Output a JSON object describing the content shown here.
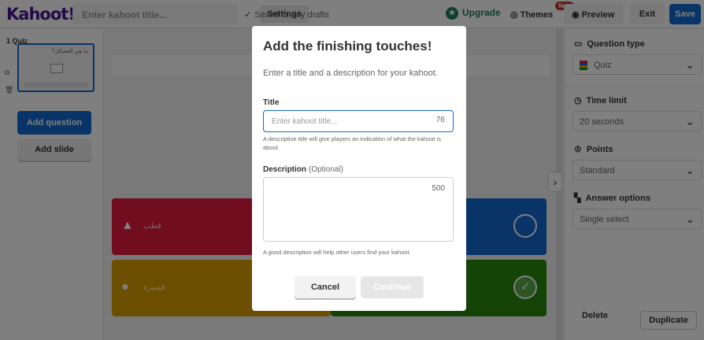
{
  "topbar": {
    "logo": "Kahoot!",
    "title_placeholder": "Enter kahoot title...",
    "settings_label": "Settings",
    "saved_text": "Saved to: My drafts",
    "upgrade_label": "Upgrade",
    "themes_label": "Themes",
    "new_badge": "New",
    "preview_label": "Preview",
    "exit_label": "Exit",
    "save_label": "Save"
  },
  "sidebar": {
    "slide_label": "1 Quiz",
    "slide_question_text": "ما هي الفصائل؟",
    "add_question_label": "Add question",
    "add_slide_label": "Add slide"
  },
  "answers": {
    "red_text": "قطب",
    "yellow_text": "فسيرة"
  },
  "right_panel": {
    "question_type_heading": "Question type",
    "question_type_value": "Quiz",
    "time_limit_heading": "Time limit",
    "time_limit_value": "20 seconds",
    "points_heading": "Points",
    "points_value": "Standard",
    "answer_options_heading": "Answer options",
    "answer_options_value": "Single select",
    "delete_label": "Delete",
    "duplicate_label": "Duplicate"
  },
  "modal": {
    "heading": "Add the finishing touches!",
    "subtitle": "Enter a title and a description for your kahoot.",
    "title_label": "Title",
    "title_placeholder": "Enter kahoot title...",
    "title_counter": "76",
    "title_hint": "A descriptive title will give players an indication of what the kahoot is about.",
    "description_label": "Description",
    "description_optional": "(Optional)",
    "description_counter": "500",
    "description_hint": "A good description will help other users find your kahoot.",
    "cancel_label": "Cancel",
    "continue_label": "Continue"
  },
  "colors": {
    "brand_purple": "#46178f",
    "primary_blue": "#1368ce",
    "answer_red": "#e21b3c",
    "answer_blue": "#1368ce",
    "answer_yellow": "#d89e00",
    "answer_green": "#26890c",
    "upgrade_green": "#1a7f5a"
  }
}
